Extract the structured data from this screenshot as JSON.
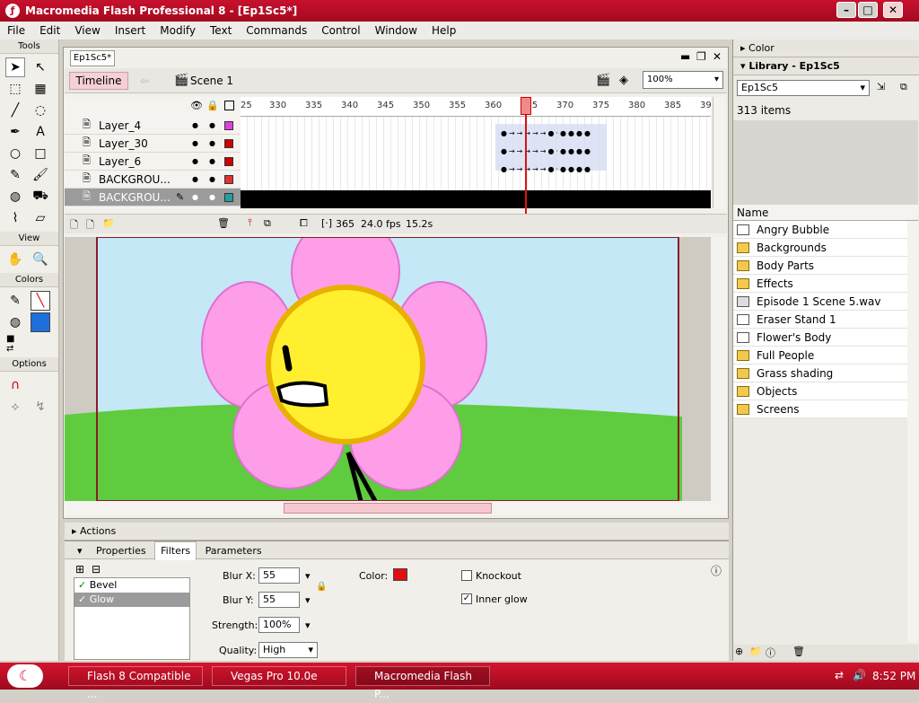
{
  "window": {
    "title": "Macromedia Flash Professional 8 - [Ep1Sc5*]"
  },
  "menu": [
    "File",
    "Edit",
    "View",
    "Insert",
    "Modify",
    "Text",
    "Commands",
    "Control",
    "Window",
    "Help"
  ],
  "tools": {
    "header": "Tools",
    "view_header": "View",
    "colors_header": "Colors",
    "options_header": "Options"
  },
  "document": {
    "tab": "Ep1Sc5*",
    "timeline_button": "Timeline",
    "scene": "Scene 1",
    "zoom": "100%"
  },
  "timeline": {
    "ruler_ticks": [
      "25",
      "330",
      "335",
      "340",
      "345",
      "350",
      "355",
      "360",
      "365",
      "370",
      "375",
      "380",
      "385",
      "39"
    ],
    "layers": [
      "Layer_4",
      "Layer_30",
      "Layer_6",
      "BACKGROU...",
      "BACKGROU..."
    ],
    "layer_colors": [
      "#e040e0",
      "#d00000",
      "#d00000",
      "#e03030",
      "#20a0a0"
    ],
    "frame": "365",
    "fps": "24.0 fps",
    "time": "15.2s"
  },
  "panels": {
    "actions": "Actions",
    "color": "Color"
  },
  "properties": {
    "tabs": [
      "Properties",
      "Filters",
      "Parameters"
    ],
    "filters": [
      "Bevel",
      "Glow"
    ],
    "blur_x_label": "Blur X:",
    "blur_x": "55",
    "blur_y_label": "Blur Y:",
    "blur_y": "55",
    "strength_label": "Strength:",
    "strength": "100%",
    "quality_label": "Quality:",
    "quality": "High",
    "color_label": "Color:",
    "knockout": "Knockout",
    "inner_glow": "Inner glow"
  },
  "library": {
    "title": "Library - Ep1Sc5",
    "doc": "Ep1Sc5",
    "count": "313 items",
    "name_header": "Name",
    "items": [
      "Angry Bubble",
      "Backgrounds",
      "Body Parts",
      "Effects",
      "Episode 1 Scene 5.wav",
      "Eraser Stand 1",
      "Flower's Body",
      "Full People",
      "Grass shading",
      "Objects",
      "Screens"
    ]
  },
  "taskbar": {
    "items": [
      "Flash 8 Compatible ...",
      "Vegas Pro 10.0e",
      "Macromedia Flash P..."
    ],
    "clock": "8:52 PM"
  }
}
